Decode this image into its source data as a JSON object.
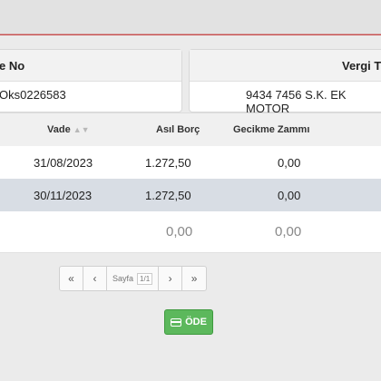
{
  "info": {
    "box1_label": "e No",
    "box1_value": "Oks0226583",
    "box2_label": "Vergi T",
    "box2_value": "9434 7456 S.K. EK MOTOR"
  },
  "table": {
    "headers": {
      "vade": "Vade",
      "asil_borc": "Asıl Borç",
      "gecikme_zammi": "Gecikme Zammı"
    },
    "rows": [
      {
        "vade": "31/08/2023",
        "asil_borc": "1.272,50",
        "gecikme_zammi": "0,00"
      },
      {
        "vade": "30/11/2023",
        "asil_borc": "1.272,50",
        "gecikme_zammi": "0,00"
      }
    ],
    "totals": {
      "asil_borc": "0,00",
      "gecikme_zammi": "0,00"
    }
  },
  "pager": {
    "first": "«",
    "prev": "‹",
    "label": "Sayfa",
    "current": "1",
    "total": "/1",
    "next": "›",
    "last": "»"
  },
  "actions": {
    "pay_label": "ÖDE"
  },
  "icons": {
    "sort": "sort-icon",
    "card": "credit-card-icon"
  },
  "colors": {
    "pay_button": "#5cb85c",
    "selected_row": "#d8dde4",
    "accent_line": "#c74d4d"
  }
}
